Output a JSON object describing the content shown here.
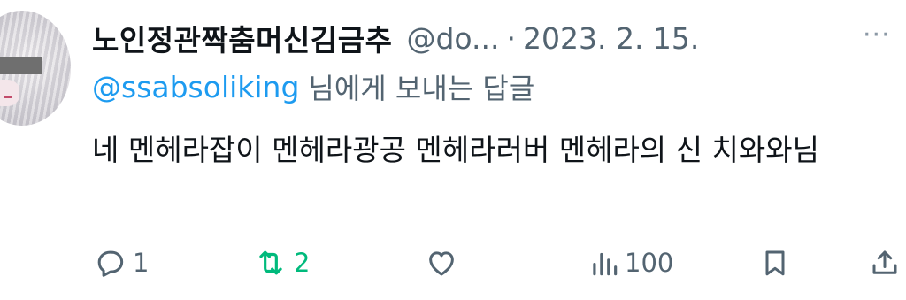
{
  "tweet": {
    "author_name": "노인정관짝춤머신김금추",
    "author_handle": "@do...",
    "separator": "·",
    "date": "2023. 2. 15.",
    "more_label": "···",
    "reply_to_handle": "@ssabsoliking",
    "reply_to_suffix": "님에게 보내는 답글",
    "text": "네 멘헤라잡이 멘헤라광공 멘헤라러버 멘헤라의 신 치와와님"
  },
  "actions": {
    "reply_count": "1",
    "retweet_count": "2",
    "views_count": "100"
  },
  "icons": {
    "reply": "reply-bubble-icon",
    "retweet": "retweet-icon",
    "like": "heart-icon",
    "views": "views-bar-chart-icon",
    "bookmark": "bookmark-icon",
    "share": "share-icon"
  },
  "colors": {
    "text": "#0f1419",
    "secondary": "#536471",
    "link": "#1d9bf0",
    "retweet_active": "#00ba7c"
  }
}
